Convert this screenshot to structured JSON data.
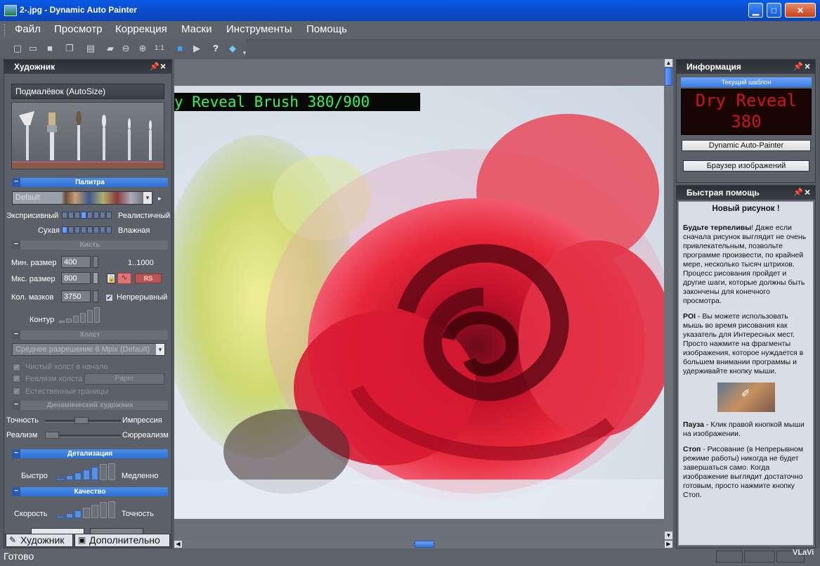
{
  "window": {
    "title": "2-.jpg - Dynamic Auto Painter",
    "controls": {
      "minimize": "▁",
      "maximize": "□",
      "close": "✕"
    }
  },
  "menu": [
    "Файл",
    "Просмотр",
    "Коррекция",
    "Маски",
    "Инструменты",
    "Помощь"
  ],
  "toolbar": {
    "zoom_label": "1:1"
  },
  "left_panel": {
    "title": "Художник",
    "style_name": "Подмалёвок (AutoSize)",
    "palette_section": "Палитра",
    "palette_select": "Default",
    "expressive": "Эксприсивный",
    "realistic": "Реалистичный",
    "dry": "Сухая",
    "wet": "Влажная",
    "brush_section": "Кисть",
    "min_size_label": "Мин. размер",
    "min_size_value": "400",
    "range_label": "1..1000",
    "max_size_label": "Мкс. размер",
    "max_size_value": "800",
    "rs_button": "RS",
    "mask_count_label": "Кол. мазков",
    "mask_count_value": "3750",
    "continuous_label": "Непрерывный",
    "contour_label": "Контур",
    "canvas_section": "Холст",
    "canvas_select": "Среднее разрешение 6 Mpix (Default)",
    "clean_canvas": "Чистый холст в начале",
    "canvas_realism": "Реализм холста",
    "paper": "Paper",
    "natural_borders": "Естественные границы",
    "dynamic_section": "Динамический художник",
    "accuracy": "Точность",
    "impression": "Импрессия",
    "realism": "Реализм",
    "surrealism": "Сюрреализм",
    "detail_section": "Детализация",
    "fast": "Быстро",
    "slow": "Медленно",
    "quality_section": "Качество",
    "speed": "Скорость",
    "accuracy2": "Точность",
    "tab_painter": "Художник",
    "tab_extra": "Дополнительно"
  },
  "canvas": {
    "overlay_text": "y Reveal Brush 380/900"
  },
  "info_panel": {
    "title": "Информация",
    "template_caption": "Текущий шаблон",
    "template_name": "Dry Reveal",
    "template_number": "380",
    "btn_dap": "Dynamic Auto-Painter",
    "btn_browser": "Браузер изображений"
  },
  "help_panel": {
    "title": "Быстрая помощь",
    "heading": "Новый рисунок !",
    "p1_bold": "Будьте терпеливы",
    "p1_text": "! Даже если сначала рисунок выглядит не очень привлекательным, позвольте программе произвести, по крайней мере, несколько тысяч штрихов. Процесс рисования пройдет и другие шаги, которые должны быть закончены для конечного просмотра.",
    "p2_bold": "POI",
    "p2_text": " - Вы можете использовать мышь во время рисования как указатель для Интересных мест. Просто нажмите на фрагменты изображения, которое нуждается в большем внимании программы и удерживайте кнопку мыши.",
    "p3_bold": "Пауза",
    "p3_text": " - Клик правой кнопкой мыши на изображении.",
    "p4_bold": "Стоп",
    "p4_text": " - Рисование (в Непрерывном режиме работы) никогда не будет завершаться само. Когда изображение выглядит достаточно готовым, просто нажмите кнопку Стоп."
  },
  "status": {
    "text": "Готово",
    "watermark": "VLaVi"
  }
}
